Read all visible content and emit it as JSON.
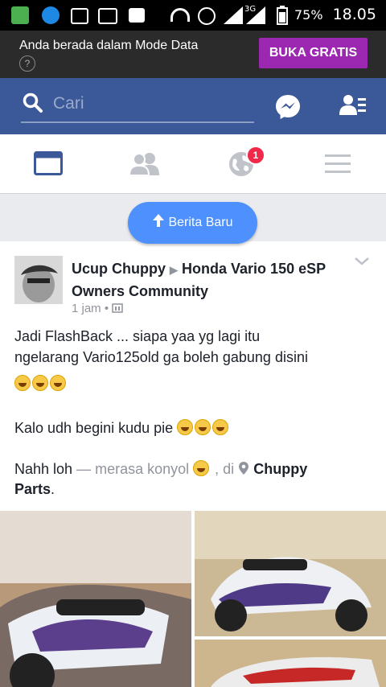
{
  "status_bar": {
    "battery": "75%",
    "time": "18.05",
    "network": "3G"
  },
  "banner": {
    "text": "Anda berada dalam Mode Data",
    "help": "?",
    "button": "BUKA GRATIS"
  },
  "header": {
    "search_placeholder": "Cari"
  },
  "tabs": {
    "notifications_badge": "1"
  },
  "new_stories_label": "Berita Baru",
  "post": {
    "author": "Ucup Chuppy",
    "arrow": "▶",
    "group": "Honda Vario 150 eSP Owners Community",
    "time": "1 jam",
    "line1": "Jadi FlashBack ... siapa yaa yg lagi itu",
    "line2": "ngelarang Vario125old ga boleh gabung disini",
    "line4": "Kalo udh begini kudu pie",
    "line5_prefix": "Nahh loh",
    "line5_feeling": "— merasa konyol",
    "line5_at": ", di",
    "place_part1": "Chuppy",
    "place_part2": "Parts",
    "place_end": "."
  },
  "colors": {
    "fb_blue": "#3b5998",
    "banner_button": "#9c27b0",
    "pill": "#4d90fe",
    "badge": "#f02849"
  }
}
